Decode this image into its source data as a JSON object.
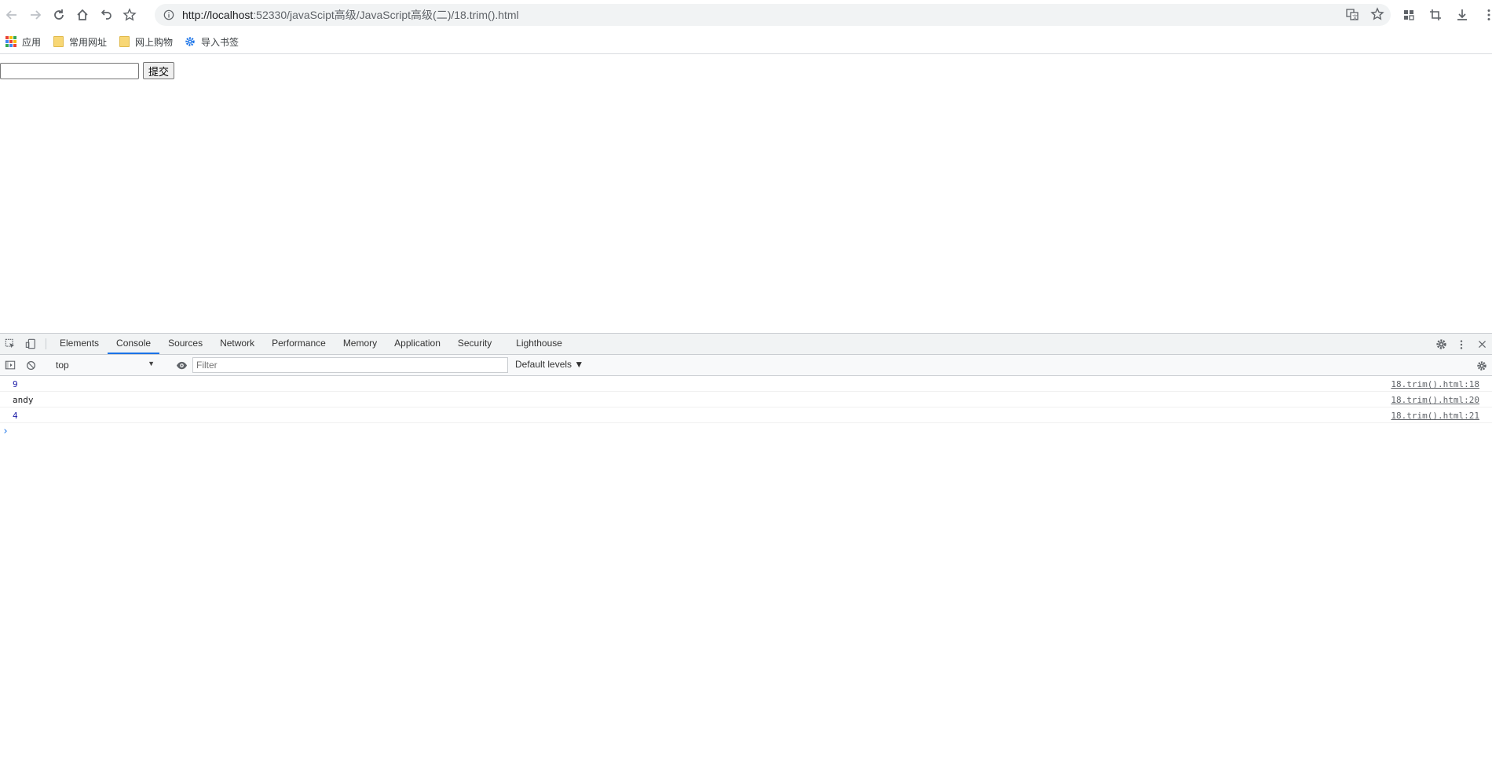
{
  "browser": {
    "url_scheme_host": "http://localhost",
    "url_rest": ":52330/javaScipt高级/JavaScript高级(二)/18.trim().html",
    "icons": [
      "back-icon",
      "forward-icon",
      "reload-icon",
      "home-icon",
      "undo-icon",
      "star-icon",
      "info-icon",
      "translate-icon",
      "bookmark-star-icon",
      "extensions-icon",
      "crop-icon",
      "download-icon",
      "menu-icon"
    ]
  },
  "bookmarks": [
    {
      "label": "应用",
      "icon": "apps-icon"
    },
    {
      "label": "常用网址",
      "icon": "folder-icon"
    },
    {
      "label": "网上购物",
      "icon": "folder-icon"
    },
    {
      "label": "导入书签",
      "icon": "gear-icon"
    }
  ],
  "page": {
    "input_value": "",
    "submit_label": "提交"
  },
  "devtools": {
    "tabs": [
      "Elements",
      "Console",
      "Sources",
      "Network",
      "Performance",
      "Memory",
      "Application",
      "Security",
      "Lighthouse"
    ],
    "active_tab": "Console",
    "context": "top",
    "filter_placeholder": "Filter",
    "levels_label": "Default levels ▼",
    "messages": [
      {
        "text": "9",
        "type": "number",
        "source": "18.trim().html:18"
      },
      {
        "text": "andy",
        "type": "string",
        "source": "18.trim().html:20"
      },
      {
        "text": "4",
        "type": "number",
        "source": "18.trim().html:21"
      }
    ],
    "prompt_symbol": "›"
  },
  "colors": {
    "accent": "#1a73e8",
    "number_output": "#1a1aa6",
    "folder": "#f8d775"
  }
}
